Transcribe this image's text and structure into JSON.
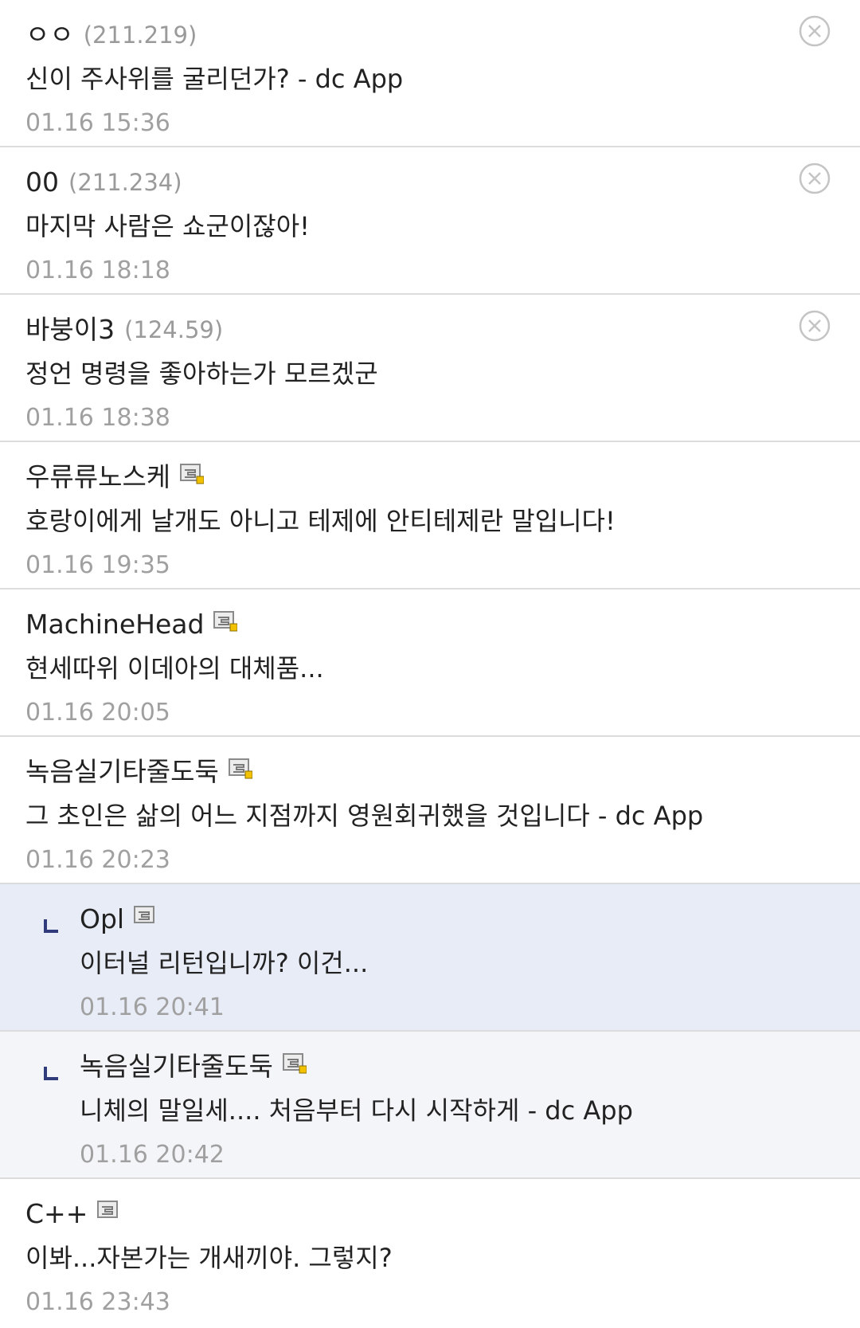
{
  "comments": [
    {
      "author": "ㅇㅇ",
      "ip": "(211.219)",
      "text": "신이 주사위를 굴리던가? - dc App",
      "date": "01.16 15:36",
      "member": false,
      "deletable": true,
      "reply": false
    },
    {
      "author": "00",
      "ip": "(211.234)",
      "text": "마지막 사람은 쇼군이잖아!",
      "date": "01.16 18:18",
      "member": false,
      "deletable": true,
      "reply": false
    },
    {
      "author": "바붕이3",
      "ip": "(124.59)",
      "text": "정언 명령을 좋아하는가 모르겠군",
      "date": "01.16 18:38",
      "member": false,
      "deletable": true,
      "reply": false
    },
    {
      "author": "우류류노스케",
      "ip": "",
      "text": "호랑이에게 날개도 아니고 테제에 안티테제란 말입니다!",
      "date": "01.16 19:35",
      "member": true,
      "memberDot": true,
      "deletable": false,
      "reply": false
    },
    {
      "author": "MachineHead",
      "ip": "",
      "text": "현세따위 이데아의 대체품...",
      "date": "01.16 20:05",
      "member": true,
      "memberDot": true,
      "deletable": false,
      "reply": false
    },
    {
      "author": "녹음실기타줄도둑",
      "ip": "",
      "text": "그 초인은 삶의 어느 지점까지 영원회귀했을 것입니다 - dc App",
      "date": "01.16 20:23",
      "member": true,
      "memberDot": true,
      "deletable": false,
      "reply": false
    },
    {
      "author": "Opl",
      "ip": "",
      "text": "이터널 리턴입니까? 이건...",
      "date": "01.16 20:41",
      "member": true,
      "memberDot": false,
      "deletable": false,
      "reply": true,
      "highlight": true
    },
    {
      "author": "녹음실기타줄도둑",
      "ip": "",
      "text": "니체의 말일세.... 처음부터 다시 시작하게 - dc App",
      "date": "01.16 20:42",
      "member": true,
      "memberDot": true,
      "deletable": false,
      "reply": true,
      "highlight": false
    },
    {
      "author": "C++",
      "ip": "",
      "text": "이봐...자본가는 개새끼야. 그렇지?",
      "date": "01.16 23:43",
      "member": true,
      "memberDot": false,
      "deletable": false,
      "reply": false
    }
  ],
  "icons": {
    "delete": "close-circle-icon",
    "member": "member-badge-icon",
    "reply": "reply-arrow-icon"
  },
  "colors": {
    "reply_background": "#f4f5f9",
    "reply_highlight_background": "#e8ecf6",
    "reply_arrow": "#2f3b7a",
    "member_dot": "#f2c200"
  }
}
